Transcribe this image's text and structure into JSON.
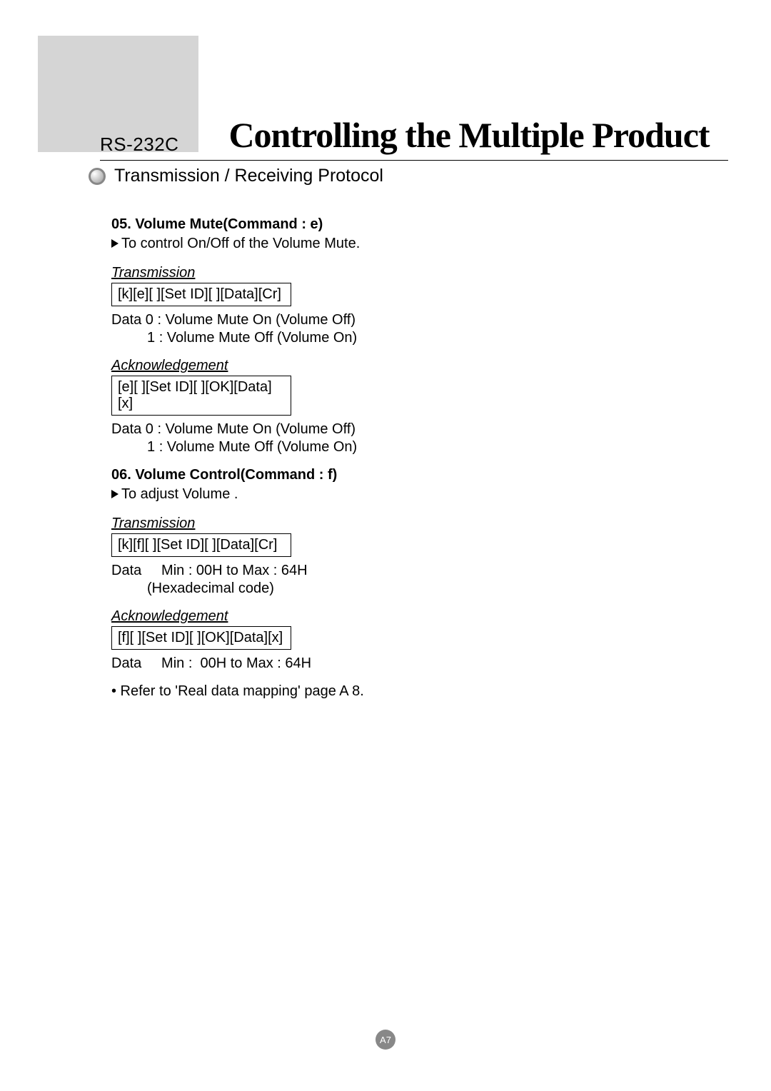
{
  "header": {
    "label": "RS-232C",
    "title": "Controlling the Multiple Product"
  },
  "subheading": "Transmission / Receiving Protocol",
  "sections": [
    {
      "title": "05. Volume  Mute(Command : e)",
      "desc": "To control On/Off of the Volume Mute.",
      "transmission_label": "Transmission",
      "transmission_code": "[k][e][ ][Set ID][ ][Data][Cr]",
      "transmission_data": [
        "Data 0 : Volume Mute On (Volume Off)",
        "         1 : Volume Mute Off (Volume On)"
      ],
      "ack_label": "Acknowledgement",
      "ack_code": "[e][ ][Set ID][ ][OK][Data][x]",
      "ack_data": [
        "Data 0 : Volume Mute On (Volume Off)",
        "         1 : Volume Mute Off (Volume On)"
      ]
    },
    {
      "title": "06. Volume  Control(Command : f)",
      "desc": "To adjust Volume .",
      "transmission_label": "Transmission",
      "transmission_code": "[k][f][ ][Set ID][ ][Data][Cr]",
      "transmission_data": [
        "Data     Min : 00H to Max : 64H",
        "         (Hexadecimal code)"
      ],
      "ack_label": "Acknowledgement",
      "ack_code": "[f][ ][Set ID][ ][OK][Data][x]",
      "ack_data": [
        "Data     Min :  00H to Max : 64H"
      ]
    }
  ],
  "note": "• Refer to 'Real data mapping' page A 8.",
  "page_number": "A7"
}
